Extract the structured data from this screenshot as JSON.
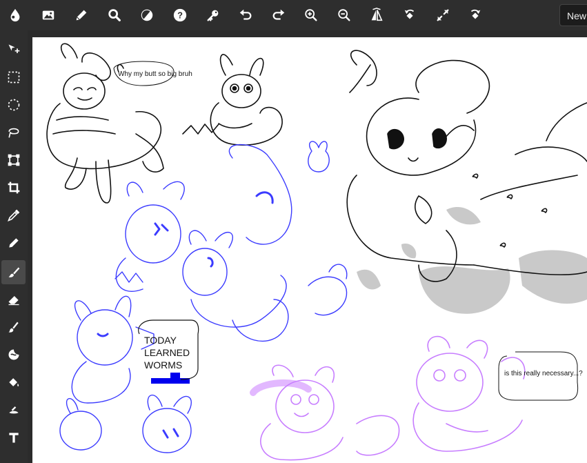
{
  "toolbar": {
    "new_label": "New",
    "icons": [
      "app-logo-icon",
      "image-icon",
      "pencil-icon",
      "search-icon",
      "adjust-icon",
      "help-icon",
      "key-icon",
      "undo-icon",
      "redo-icon",
      "zoom-in-icon",
      "zoom-out-icon",
      "flip-icon",
      "rotate-left-icon",
      "fullscreen-icon",
      "rotate-right-icon"
    ]
  },
  "tools": [
    "move",
    "rect-select",
    "ellipse-select",
    "lasso",
    "transform",
    "crop",
    "eyedropper",
    "pen",
    "brush",
    "eraser",
    "smudge",
    "blend",
    "fill",
    "gradient",
    "text"
  ],
  "active_tool": "brush",
  "canvas": {
    "annotations": {
      "note_top": "Why my butt so big bruh",
      "note_middle": [
        "TODAY",
        "LEARNED",
        "WORMS"
      ],
      "note_right": "is this really necessary...?"
    }
  },
  "colors": {
    "ui_bg": "#2e2e2e",
    "icon": "#ffffff",
    "ink_black": "#111111",
    "ink_blue": "#3b3bff",
    "ink_purple": "#c77dff",
    "shade_gray": "#c8c8c8"
  }
}
